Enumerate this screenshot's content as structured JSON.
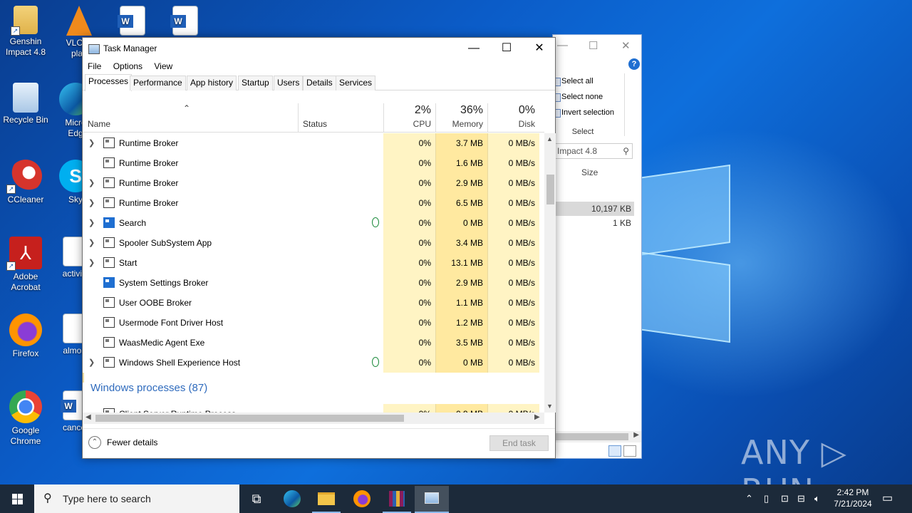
{
  "desktop": {
    "icons": [
      {
        "label": "Genshin Impact 4.8"
      },
      {
        "label": "VLC m\nplay"
      },
      {
        "label": "Recycle Bin"
      },
      {
        "label": "Micro\nEdg"
      },
      {
        "label": "CCleaner"
      },
      {
        "label": "Sky"
      },
      {
        "label": "Adobe Acrobat"
      },
      {
        "label": "activity"
      },
      {
        "label": "Firefox"
      },
      {
        "label": "almost"
      },
      {
        "label": "Google Chrome"
      },
      {
        "label": "cancer"
      }
    ],
    "watermark": "ANY ▷ RUN"
  },
  "explorer": {
    "ribbon": [
      "Select all",
      "Select none",
      "Invert selection"
    ],
    "group_label": "Select",
    "search_value": "Impact 4.8",
    "column": "Size",
    "sizes": [
      "10,197 KB",
      "1 KB"
    ]
  },
  "taskmanager": {
    "title": "Task Manager",
    "menu": [
      "File",
      "Options",
      "View"
    ],
    "tabs": [
      "Processes",
      "Performance",
      "App history",
      "Startup",
      "Users",
      "Details",
      "Services"
    ],
    "columns": {
      "name": "Name",
      "status": "Status",
      "cpu_pct": "2%",
      "cpu": "CPU",
      "mem_pct": "36%",
      "mem": "Memory",
      "disk_pct": "0%",
      "disk": "Disk"
    },
    "processes": [
      {
        "name": "Runtime Broker",
        "expand": true,
        "cpu": "0%",
        "mem": "3.7 MB",
        "disk": "0 MB/s"
      },
      {
        "name": "Runtime Broker",
        "expand": false,
        "cpu": "0%",
        "mem": "1.6 MB",
        "disk": "0 MB/s"
      },
      {
        "name": "Runtime Broker",
        "expand": true,
        "cpu": "0%",
        "mem": "2.9 MB",
        "disk": "0 MB/s"
      },
      {
        "name": "Runtime Broker",
        "expand": true,
        "cpu": "0%",
        "mem": "6.5 MB",
        "disk": "0 MB/s"
      },
      {
        "name": "Search",
        "expand": true,
        "icon": "search",
        "suspended": true,
        "cpu": "0%",
        "mem": "0 MB",
        "disk": "0 MB/s"
      },
      {
        "name": "Spooler SubSystem App",
        "expand": true,
        "cpu": "0%",
        "mem": "3.4 MB",
        "disk": "0 MB/s"
      },
      {
        "name": "Start",
        "expand": true,
        "cpu": "0%",
        "mem": "13.1 MB",
        "disk": "0 MB/s"
      },
      {
        "name": "System Settings Broker",
        "expand": false,
        "icon": "gear",
        "cpu": "0%",
        "mem": "2.9 MB",
        "disk": "0 MB/s"
      },
      {
        "name": "User OOBE Broker",
        "expand": false,
        "cpu": "0%",
        "mem": "1.1 MB",
        "disk": "0 MB/s"
      },
      {
        "name": "Usermode Font Driver Host",
        "expand": false,
        "cpu": "0%",
        "mem": "1.2 MB",
        "disk": "0 MB/s"
      },
      {
        "name": "WaasMedic Agent Exe",
        "expand": false,
        "cpu": "0%",
        "mem": "3.5 MB",
        "disk": "0 MB/s"
      },
      {
        "name": "Windows Shell Experience Host",
        "expand": true,
        "suspended": true,
        "cpu": "0%",
        "mem": "0 MB",
        "disk": "0 MB/s"
      }
    ],
    "group": "Windows processes (87)",
    "after_group": {
      "name": "Client Server Runtime Process",
      "cpu": "0%",
      "mem": "0.9 MB",
      "disk": "0 MB/s"
    },
    "fewer_details": "Fewer details",
    "end_task": "End task"
  },
  "taskbar": {
    "search_placeholder": "Type here to search",
    "time": "2:42 PM",
    "date": "7/21/2024"
  }
}
